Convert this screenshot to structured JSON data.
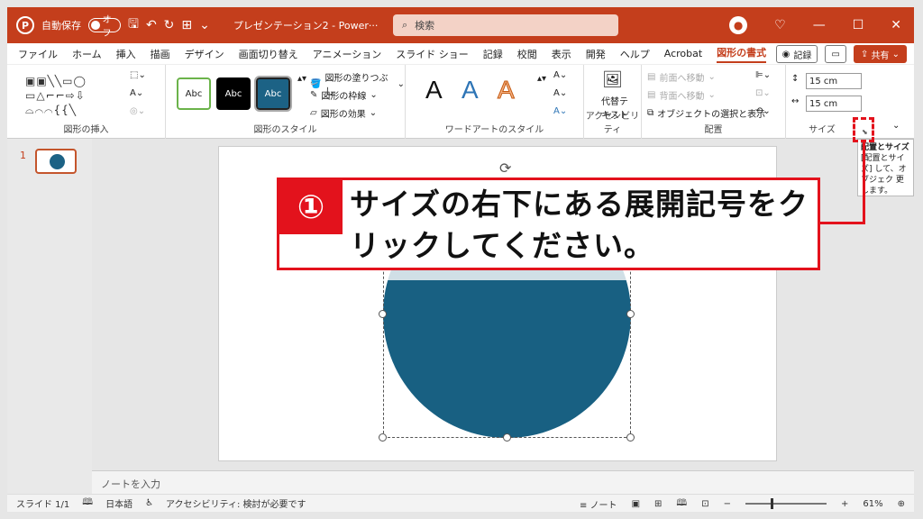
{
  "titlebar": {
    "autosave_label": "自動保存",
    "autosave_state": "オフ",
    "doc_title": "プレゼンテーション2 - Power···",
    "search_placeholder": "検索"
  },
  "menu": {
    "tabs": [
      "ファイル",
      "ホーム",
      "挿入",
      "描画",
      "デザイン",
      "画面切り替え",
      "アニメーション",
      "スライド ショー",
      "記録",
      "校閲",
      "表示",
      "開発",
      "ヘルプ",
      "Acrobat",
      "図形の書式"
    ],
    "record_label": "記録",
    "share_label": "共有"
  },
  "ribbon": {
    "insert_shapes_label": "図形の挿入",
    "shape_styles_label": "図形のスタイル",
    "style_abc": "Abc",
    "fill_label": "図形の塗りつぶし",
    "outline_label": "図形の枠線",
    "effect_label": "図形の効果",
    "wordart_label": "ワードアートのスタイル",
    "wordart_letter": "A",
    "accessibility_label": "アクセシビリティ",
    "alt_text_label": "代替テ キスト",
    "bring_forward": "前面へ移動",
    "send_backward": "背面へ移動",
    "selection_pane": "オブジェクトの選択と表示",
    "arrange_label": "配置",
    "size_label": "サイズ",
    "height_value": "15 cm",
    "width_value": "15 cm"
  },
  "thumbnail": {
    "number": "1"
  },
  "tooltip": {
    "title": "配置とサイズ",
    "body": "[配置とサイズ] して、オブジェク 更します。"
  },
  "callout": {
    "number": "①",
    "text": "サイズの右下にある展開記号をクリックしてください。"
  },
  "notes_placeholder": "ノートを入力",
  "status": {
    "slide": "スライド 1/1",
    "language": "日本語",
    "accessibility": "アクセシビリティ: 検討が必要です",
    "notes": "ノート",
    "zoom": "61%"
  },
  "colors": {
    "accent": "#c43e1c",
    "circle": "#186082",
    "callout_red": "#e3121c"
  }
}
